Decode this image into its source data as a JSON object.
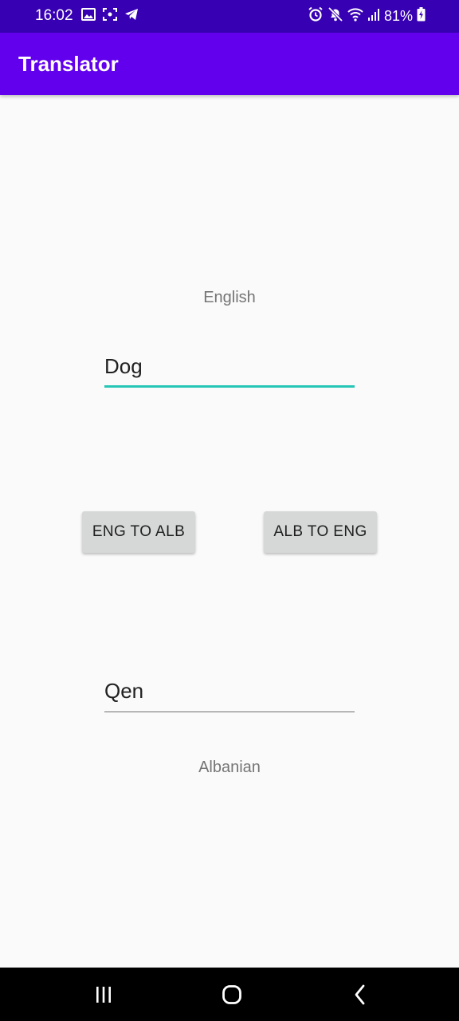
{
  "status_bar": {
    "time": "16:02",
    "battery": "81%",
    "left_icons": [
      "gallery-icon",
      "screenshot-icon",
      "telegram-icon"
    ],
    "right_icons": [
      "alarm-icon",
      "mute-icon",
      "wifi-icon",
      "signal-icon",
      "battery-charging-icon"
    ]
  },
  "app_bar": {
    "title": "Translator",
    "color": "#6200ee"
  },
  "source": {
    "language_label": "English",
    "value": "Dog",
    "accent": "#26c6b6"
  },
  "buttons": {
    "eng_to_alb": "ENG TO ALB",
    "alb_to_eng": "ALB TO ENG"
  },
  "target": {
    "value": "Qen",
    "language_label": "Albanian"
  },
  "nav_bar": {
    "icons": [
      "recent-apps-icon",
      "home-icon",
      "back-icon"
    ]
  }
}
